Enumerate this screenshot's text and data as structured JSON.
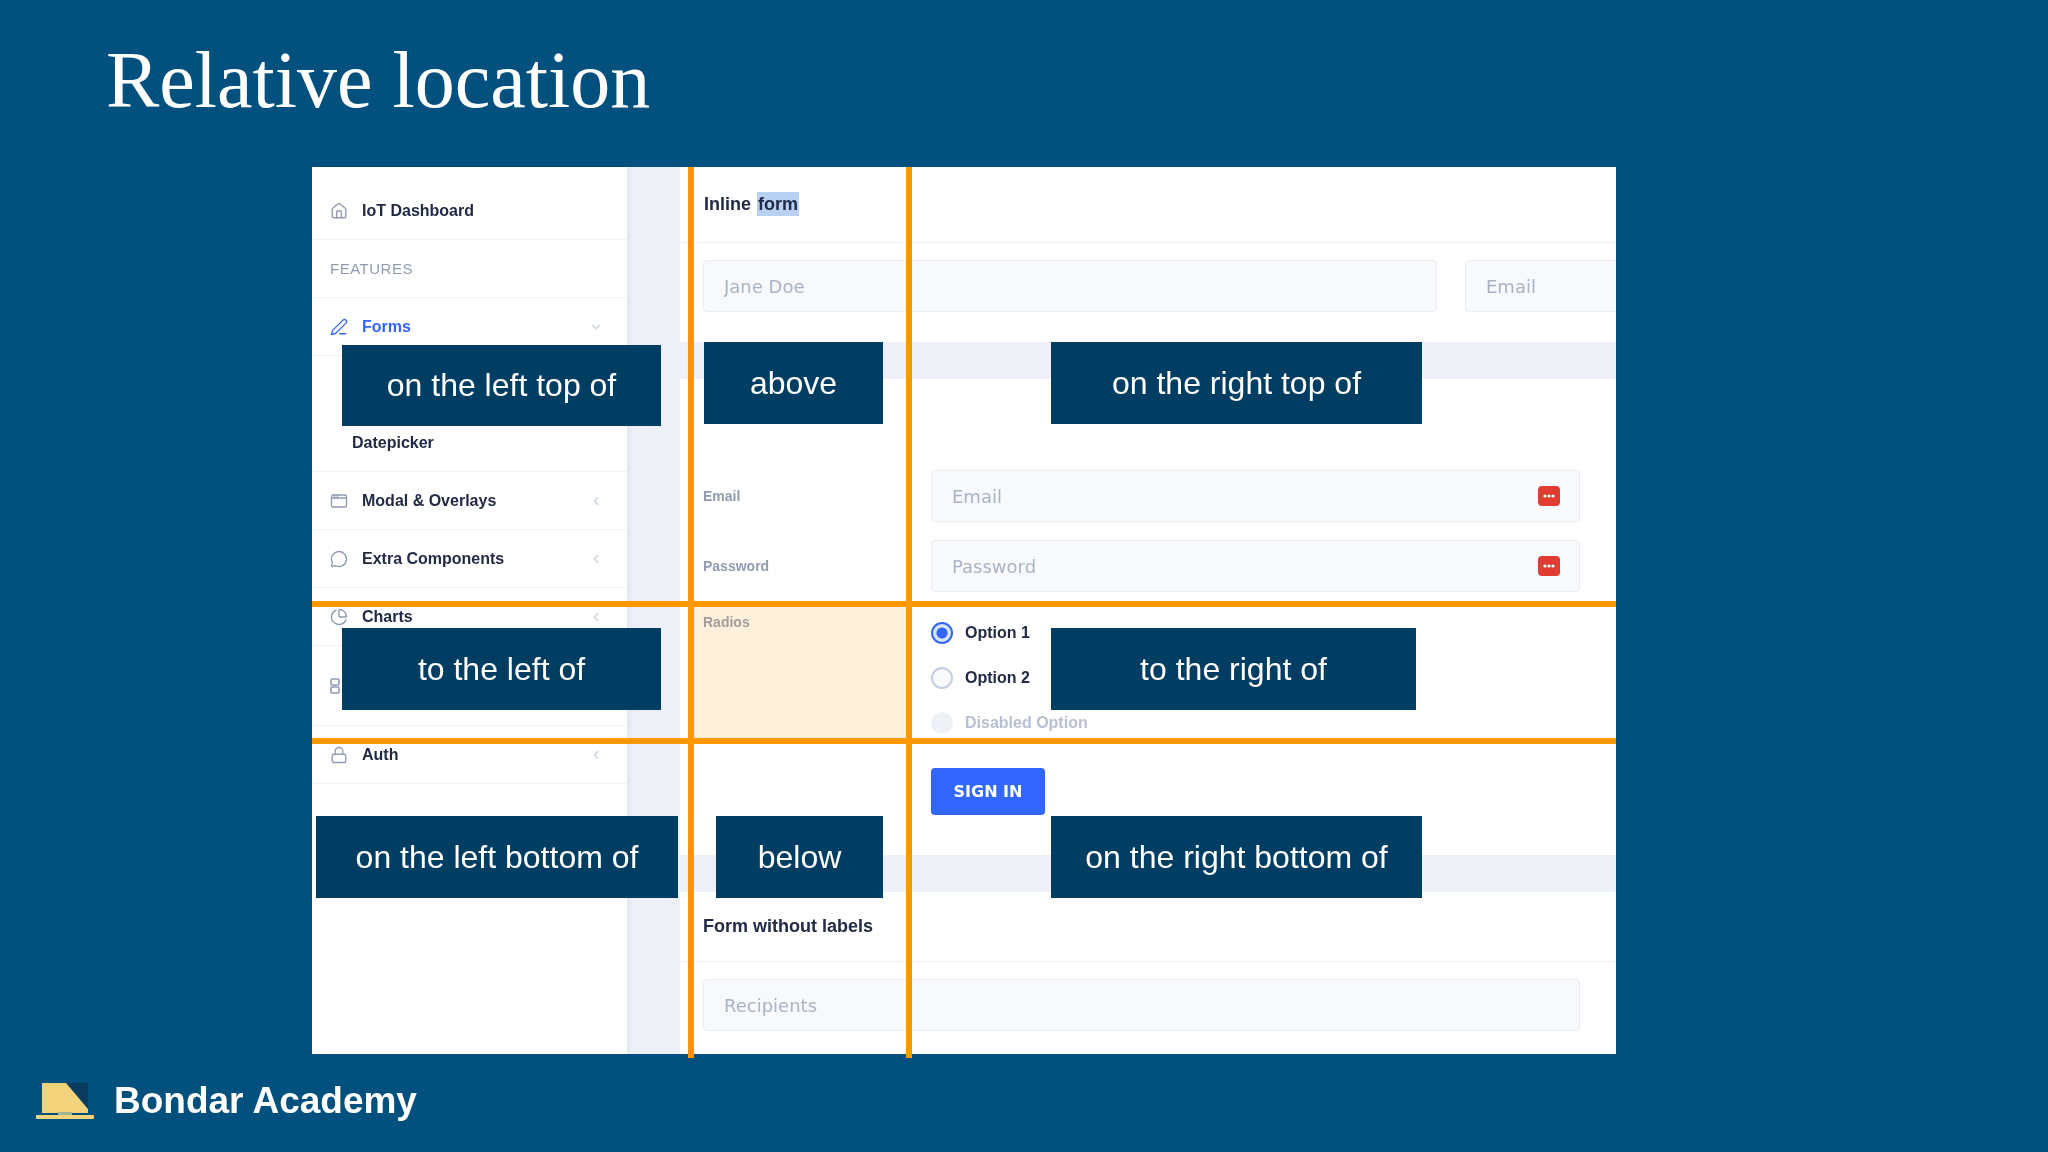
{
  "slide": {
    "title": "Relative location",
    "brand": "Bondar Academy"
  },
  "sidebar": {
    "items": [
      {
        "kind": "link",
        "label": "IoT Dashboard",
        "selected": false
      },
      {
        "kind": "heading",
        "label": "FEATURES"
      },
      {
        "kind": "group",
        "label": "Forms",
        "selected": true,
        "expanded": true,
        "children": [
          {
            "label": "Datepicker"
          }
        ]
      },
      {
        "kind": "group",
        "label": "Modal & Overlays",
        "selected": false,
        "expanded": false
      },
      {
        "kind": "group",
        "label": "Extra Components",
        "selected": false,
        "expanded": false
      },
      {
        "kind": "group",
        "label": "Charts",
        "selected": false,
        "expanded": false
      },
      {
        "kind": "icon-only"
      },
      {
        "kind": "group",
        "label": "Auth",
        "selected": false,
        "expanded": false
      }
    ]
  },
  "inline_form": {
    "title_parts": [
      {
        "text": "Inline",
        "selected": false
      },
      {
        "text": "form",
        "selected": true
      }
    ],
    "fields": [
      {
        "placeholder": "Jane Doe"
      },
      {
        "placeholder": "Email"
      }
    ]
  },
  "grid_form": {
    "rows": [
      {
        "kind": "input",
        "label": "Email",
        "placeholder": "Email"
      },
      {
        "kind": "input",
        "label": "Password",
        "placeholder": "Password"
      },
      {
        "kind": "radios",
        "label": "Radios",
        "options": [
          {
            "label": "Option 1",
            "selected": true,
            "disabled": false
          },
          {
            "label": "Option 2",
            "selected": false,
            "disabled": false
          },
          {
            "label": "Disabled Option",
            "selected": false,
            "disabled": true
          }
        ]
      }
    ],
    "button": "SIGN IN"
  },
  "form_without_labels": {
    "title": "Form without labels",
    "fields": [
      {
        "placeholder": "Recipients"
      }
    ]
  },
  "overlay_labels": [
    "on the left top of",
    "above",
    "on the right top of",
    "to the left of",
    "to the right of",
    "on the left bottom of",
    "below",
    "on the right bottom of"
  ]
}
